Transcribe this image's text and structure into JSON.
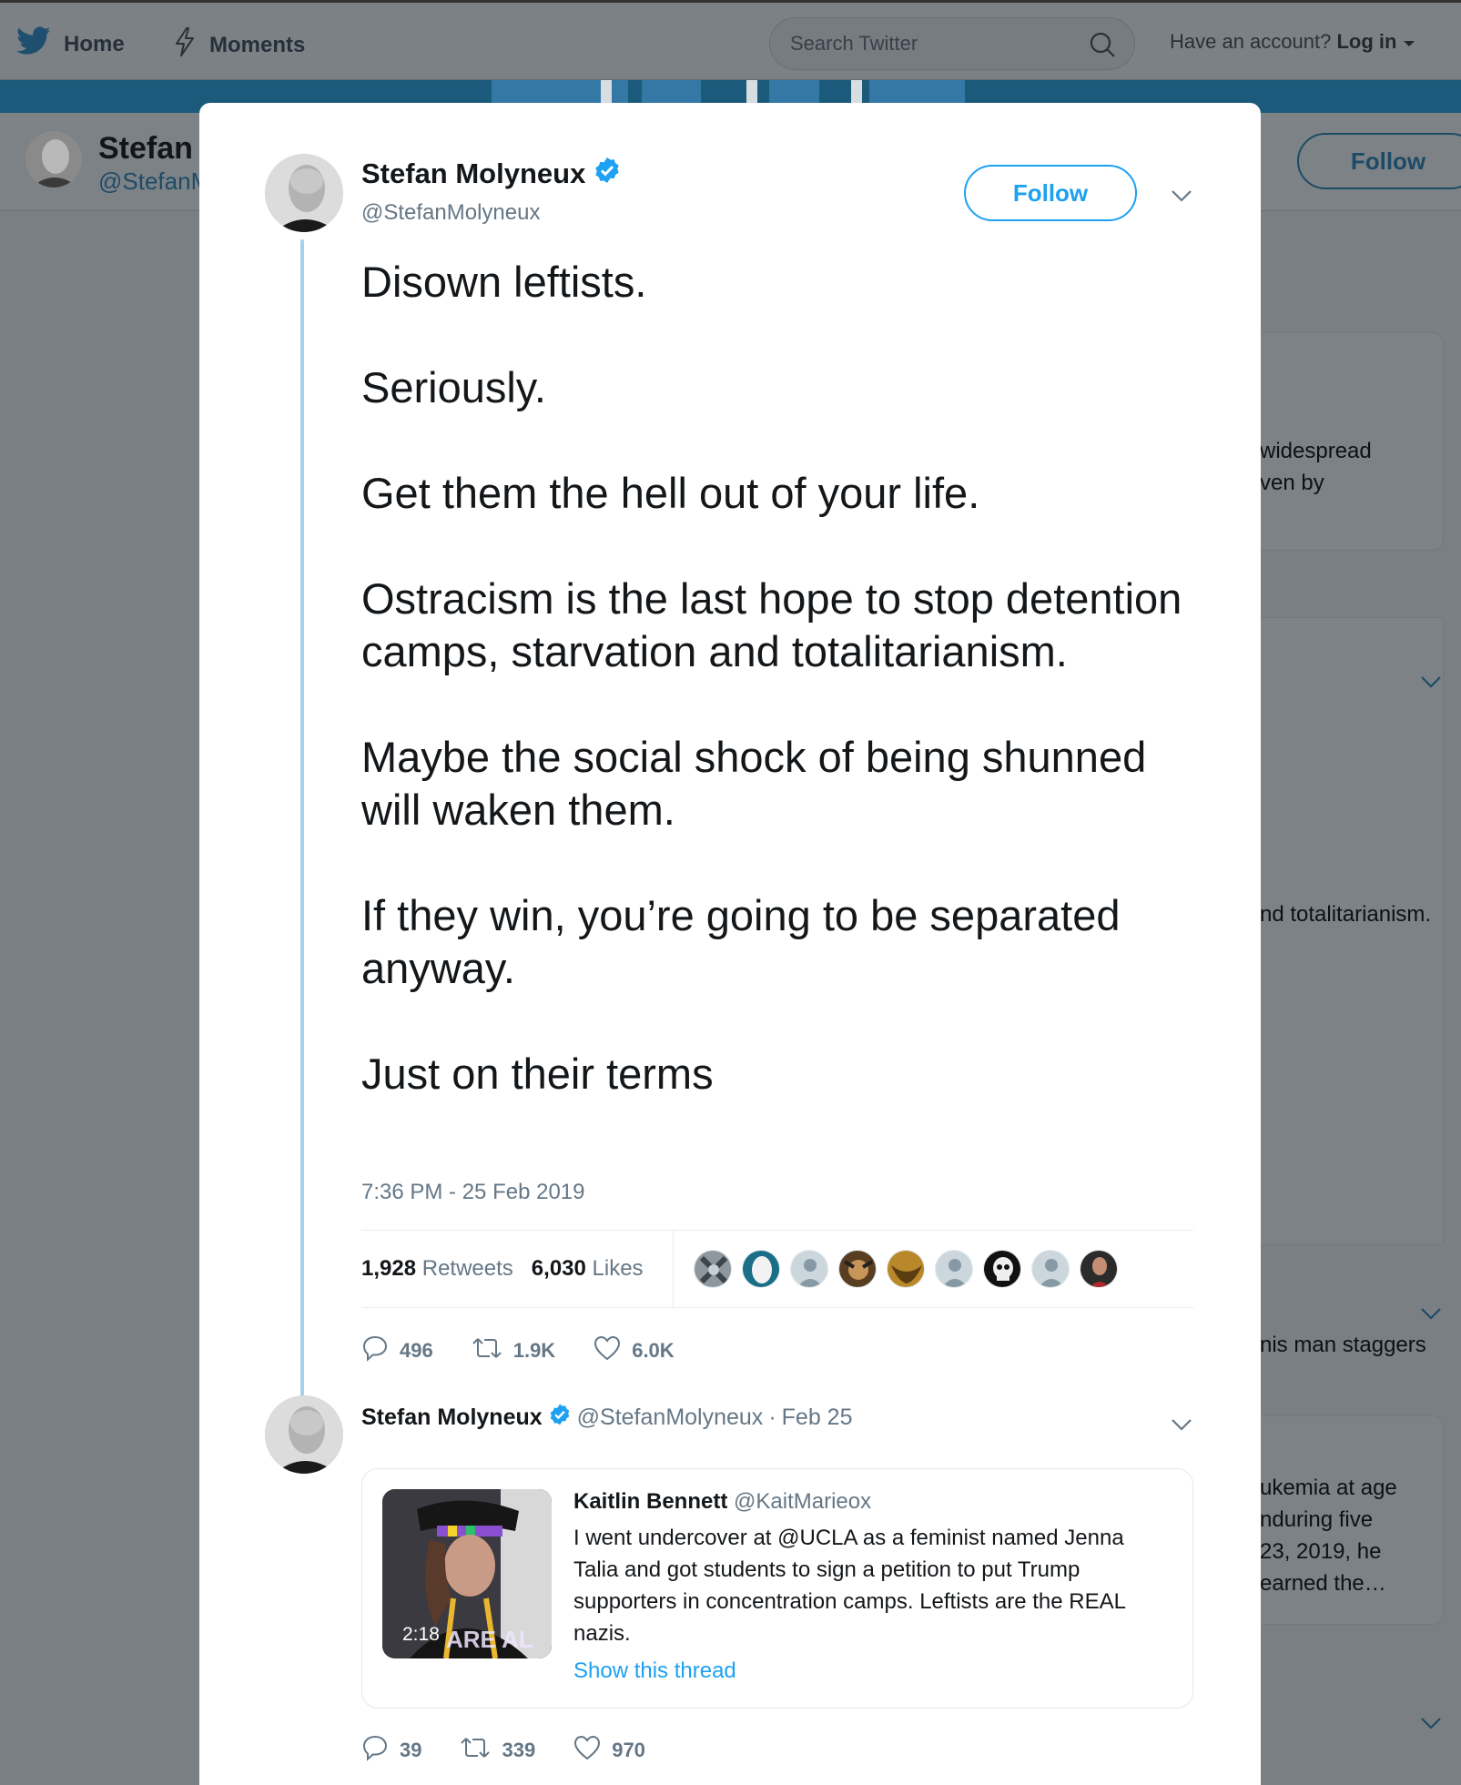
{
  "topnav": {
    "home_label": "Home",
    "moments_label": "Moments",
    "search_placeholder": "Search Twitter",
    "account_prompt": "Have an account?",
    "login_label": "Log in"
  },
  "profile_bar": {
    "name": "Stefan",
    "handle": "@StefanM",
    "follow_label": "Follow"
  },
  "background_snippets": {
    "s1_line1": "widespread",
    "s1_line2": "ven by",
    "s2": "nd totalitarianism.",
    "s3": "nis man staggers",
    "s4_line1": "ukemia at age",
    "s4_line2": "nduring five",
    "s4_line3": "23, 2019, he",
    "s4_line4": "earned the…"
  },
  "tweet": {
    "author_name": "Stefan Molyneux",
    "author_handle": "@StefanMolyneux",
    "follow_label": "Follow",
    "paragraphs": [
      "Disown leftists.",
      "Seriously.",
      "Get them the hell out of your life.",
      "Ostracism is the last hope to stop detention camps, starvation and totalitarianism.",
      "Maybe the social shock of being shunned will waken them.",
      "If they win, you’re going to be separated anyway.",
      "Just on their terms"
    ],
    "timestamp": "7:36 PM - 25 Feb 2019",
    "retweets_count": "1,928",
    "retweets_label": "Retweets",
    "likes_count": "6,030",
    "likes_label": "Likes",
    "actions": {
      "replies": "496",
      "retweets": "1.9K",
      "likes": "6.0K"
    }
  },
  "reply": {
    "author_name": "Stefan Molyneux",
    "author_handle": "@StefanMolyneux",
    "separator": "·",
    "date": "Feb 25",
    "quote": {
      "author_name": "Kaitlin Bennett",
      "author_handle": "@KaitMarieox",
      "text": "I went undercover at @UCLA as a feminist named Jenna Talia and got students to sign a petition to put Trump supporters in concentration camps. Leftists are the REAL nazis.",
      "video_duration": "2:18",
      "show_thread_label": "Show this thread"
    },
    "actions": {
      "replies": "39",
      "retweets": "339",
      "likes": "970"
    }
  },
  "colors": {
    "accent": "#1da1f2",
    "text_primary": "#14171a",
    "text_secondary": "#657786",
    "thread_line": "#a3d3ec",
    "overlay_background": "#7a7f84"
  }
}
